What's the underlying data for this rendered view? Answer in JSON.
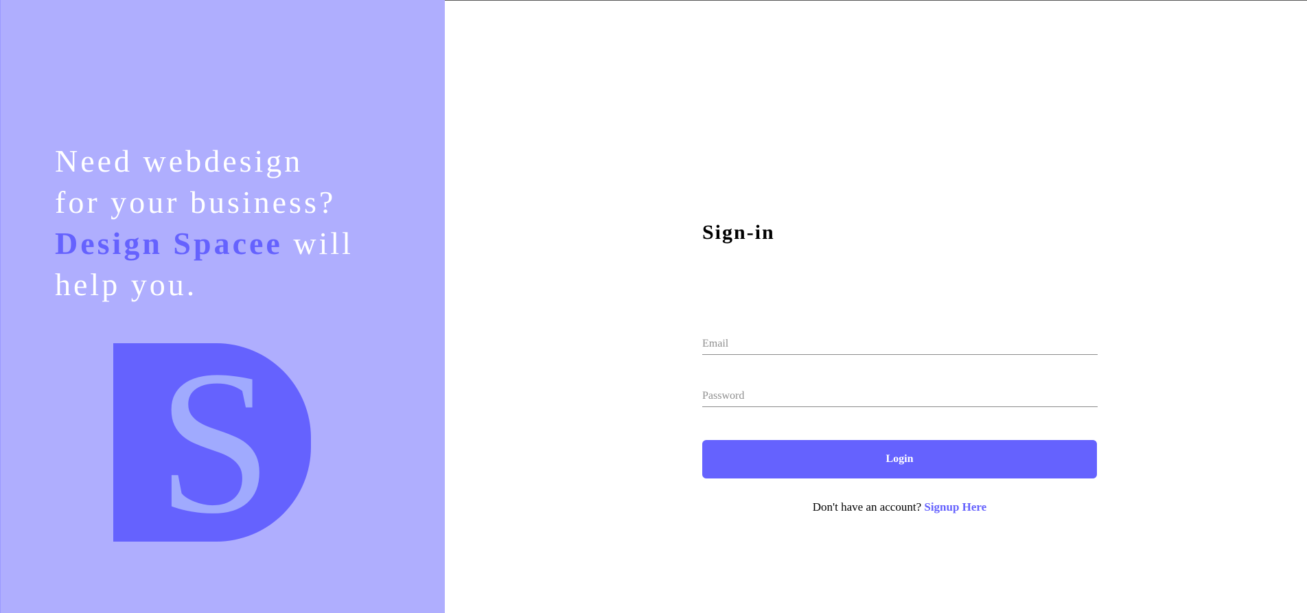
{
  "hero": {
    "line1": "Need webdesign",
    "line2": "for your business?",
    "brand": "Design Spacee",
    "line3_rest": " will",
    "line4": "help you.",
    "logo_letter": "S"
  },
  "signin": {
    "title": "Sign-in",
    "email_placeholder": "Email",
    "password_placeholder": "Password",
    "login_label": "Login",
    "no_account_text": "Don't have an account? ",
    "signup_link_label": "Signup Here"
  },
  "colors": {
    "accent": "#6562fe",
    "left_panel": "#afaefe",
    "logo_letter": "#a0aafe",
    "background": "#ffffff"
  }
}
